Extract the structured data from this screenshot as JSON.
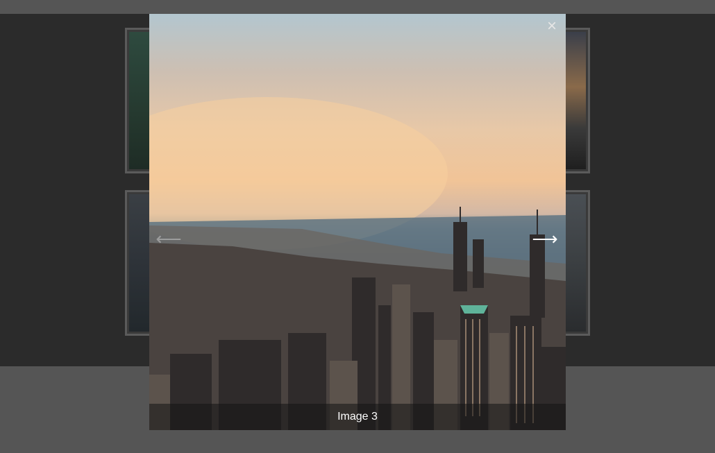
{
  "lightbox": {
    "caption": "Image 3",
    "close_glyph": "×",
    "prev_glyph": "⟵",
    "next_glyph": "⟶"
  },
  "colors": {
    "page_background": "#555555",
    "overlay_background": "#2b2b2b",
    "thumbnail_border": "#5b5b5b",
    "caption_text": "#ffffff"
  },
  "icons": [
    "close-icon",
    "arrow-left-icon",
    "arrow-right-icon"
  ]
}
